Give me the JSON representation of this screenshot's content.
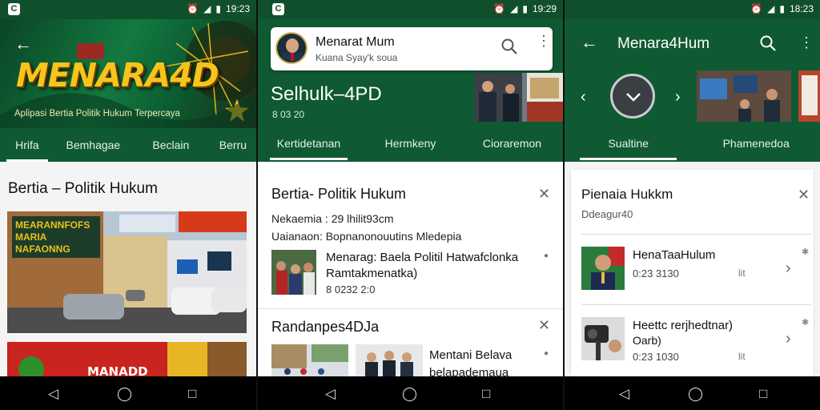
{
  "status_bar": {
    "app_icon_glyph": "C",
    "panel1_time": "19:23",
    "panel2_time": "19:29",
    "panel3_time": "18:23"
  },
  "nav_bar": {
    "back": "◁",
    "home": "◯",
    "recents": "□"
  },
  "panel1": {
    "banner_title": "MENARA4D",
    "banner_subtitle": "Aplipasi Bertia Politik Hukum Terpercaya",
    "tabs": [
      "Hrifa",
      "Bemhagae",
      "Beclain",
      "Berru"
    ],
    "section_title": "Bertia – Politik Hukum",
    "thumb1_sign": "MEARANNFOFS MARIA NAFAONNG",
    "thumb2_sign": "MANADD"
  },
  "panel2": {
    "search_title": "Menarat Mum",
    "search_subtitle": "Kuana Syay'k soua",
    "hero_title": "Selhulk–4PD",
    "hero_subtitle": "8 03 20",
    "tabs": [
      "Kertidetanan",
      "Hermkeny",
      "Cioraremon"
    ],
    "card_title": "Bertia- Politik Hukum",
    "meta1": "Nekaemia : 29 lhilit93cm",
    "meta2": "Uaianaon: Bopnanonouutins Mledepia",
    "article_title": "Menarag: Baela Politil Hatwafclonka Ramtakmenatka)",
    "article_date": "8 0232 2:0",
    "section2_title": "Randanpes4DJa",
    "article2_title": "Mentani Belava belapademaua Jamiu"
  },
  "panel3": {
    "title": "Menara4Hum",
    "tabs": [
      "Sualtine",
      "Phamenedoa"
    ],
    "card_title": "Pienaia Hukkm",
    "card_subtitle": "Ddeagur40",
    "items": [
      {
        "title": "HenaTaaHulum",
        "time": "0:23 3130",
        "badge": "lit"
      },
      {
        "title": "Heettc rerjhedtnar)",
        "sub": "Oarb)",
        "time": "0:23 1030",
        "badge": "lit"
      }
    ]
  },
  "colors": {
    "primary_green": "#0f5a32",
    "dark_green": "#0a4526",
    "gold": "#f2c21b"
  }
}
